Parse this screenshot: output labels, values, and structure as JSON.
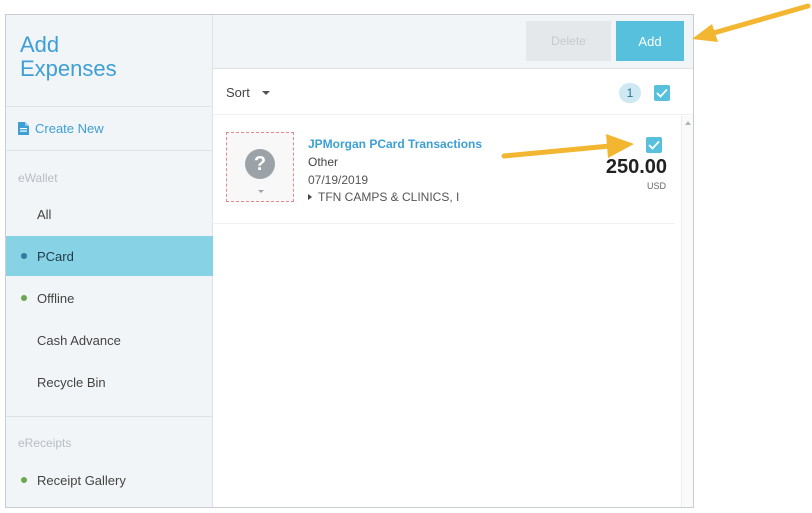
{
  "sidebar": {
    "title_line1": "Add",
    "title_line2": "Expenses",
    "create_new": "Create New",
    "ewallet_label": "eWallet",
    "ewallet_items": [
      {
        "label": "All",
        "dot": false,
        "active": false
      },
      {
        "label": "PCard",
        "dot": true,
        "active": true
      },
      {
        "label": "Offline",
        "dot": true,
        "active": false
      },
      {
        "label": "Cash Advance",
        "dot": false,
        "active": false
      },
      {
        "label": "Recycle Bin",
        "dot": false,
        "active": false
      }
    ],
    "ereceipts_label": "eReceipts",
    "ereceipts_items": [
      {
        "label": "Receipt Gallery",
        "dot": true,
        "active": false
      }
    ]
  },
  "toolbar": {
    "delete_label": "Delete",
    "add_label": "Add"
  },
  "sortbar": {
    "sort_label": "Sort",
    "selected_count": "1"
  },
  "expense": {
    "title": "JPMorgan PCard Transactions",
    "type": "Other",
    "date": "07/19/2019",
    "vendor": "TFN CAMPS & CLINICS, I",
    "amount": "250.00",
    "currency": "USD",
    "thumbnail_icon": "?",
    "checked": true
  },
  "colors": {
    "accent": "#3d9fd6",
    "add_button": "#56c0dd",
    "active_nav": "#88d2e6",
    "status_dot": "#6aa84f",
    "annotation_arrow": "#f2b631"
  },
  "icons": [
    "document-icon",
    "question-icon",
    "checkbox-icon",
    "sort-caret-icon",
    "expand-caret-icon",
    "arrow-annotation-icon"
  ]
}
